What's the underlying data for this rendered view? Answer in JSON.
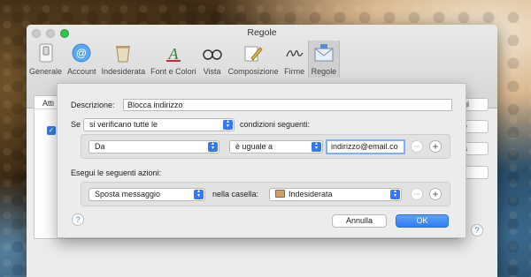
{
  "window": {
    "title": "Regole",
    "traffic_lights": {
      "close_color": "#c9c9c9",
      "minimize_color": "#c9c9c9",
      "zoom_color": "#35c24a"
    }
  },
  "toolbar": {
    "items": [
      {
        "label": "Generale",
        "icon": "switch-icon",
        "active": false
      },
      {
        "label": "Account",
        "icon": "at-sign-icon",
        "active": false
      },
      {
        "label": "Indesiderata",
        "icon": "trash-junk-icon",
        "active": false
      },
      {
        "label": "Font e Colori",
        "icon": "font-icon",
        "active": false
      },
      {
        "label": "Vista",
        "icon": "glasses-icon",
        "active": false
      },
      {
        "label": "Composizione",
        "icon": "pencil-icon",
        "active": false
      },
      {
        "label": "Firme",
        "icon": "signature-icon",
        "active": false
      },
      {
        "label": "Regole",
        "icon": "rules-envelope-icon",
        "active": true
      }
    ]
  },
  "rules_list": {
    "column_header": "Atti",
    "side_buttons": [
      "gi",
      "e",
      "a",
      "i"
    ]
  },
  "sheet": {
    "description_label": "Descrizione:",
    "description_value": "Blocca indirizzo",
    "if_label": "Se",
    "condition_mode": "si verificano tutte le",
    "conditions_suffix": "condizioni seguenti:",
    "condition": {
      "field": "Da",
      "operator": "è uguale a",
      "value": "indirizzo@email.co"
    },
    "actions_label": "Esegui le seguenti azioni:",
    "action": {
      "type": "Sposta messaggio",
      "mailbox_label": "nella casella:",
      "mailbox": "Indesiderata"
    },
    "cancel_label": "Annulla",
    "ok_label": "OK",
    "help_label": "?",
    "remove_symbol": "−",
    "add_symbol": "+"
  },
  "colors": {
    "accent": "#2f7ef3",
    "focus_ring": "#7fb0f5"
  }
}
